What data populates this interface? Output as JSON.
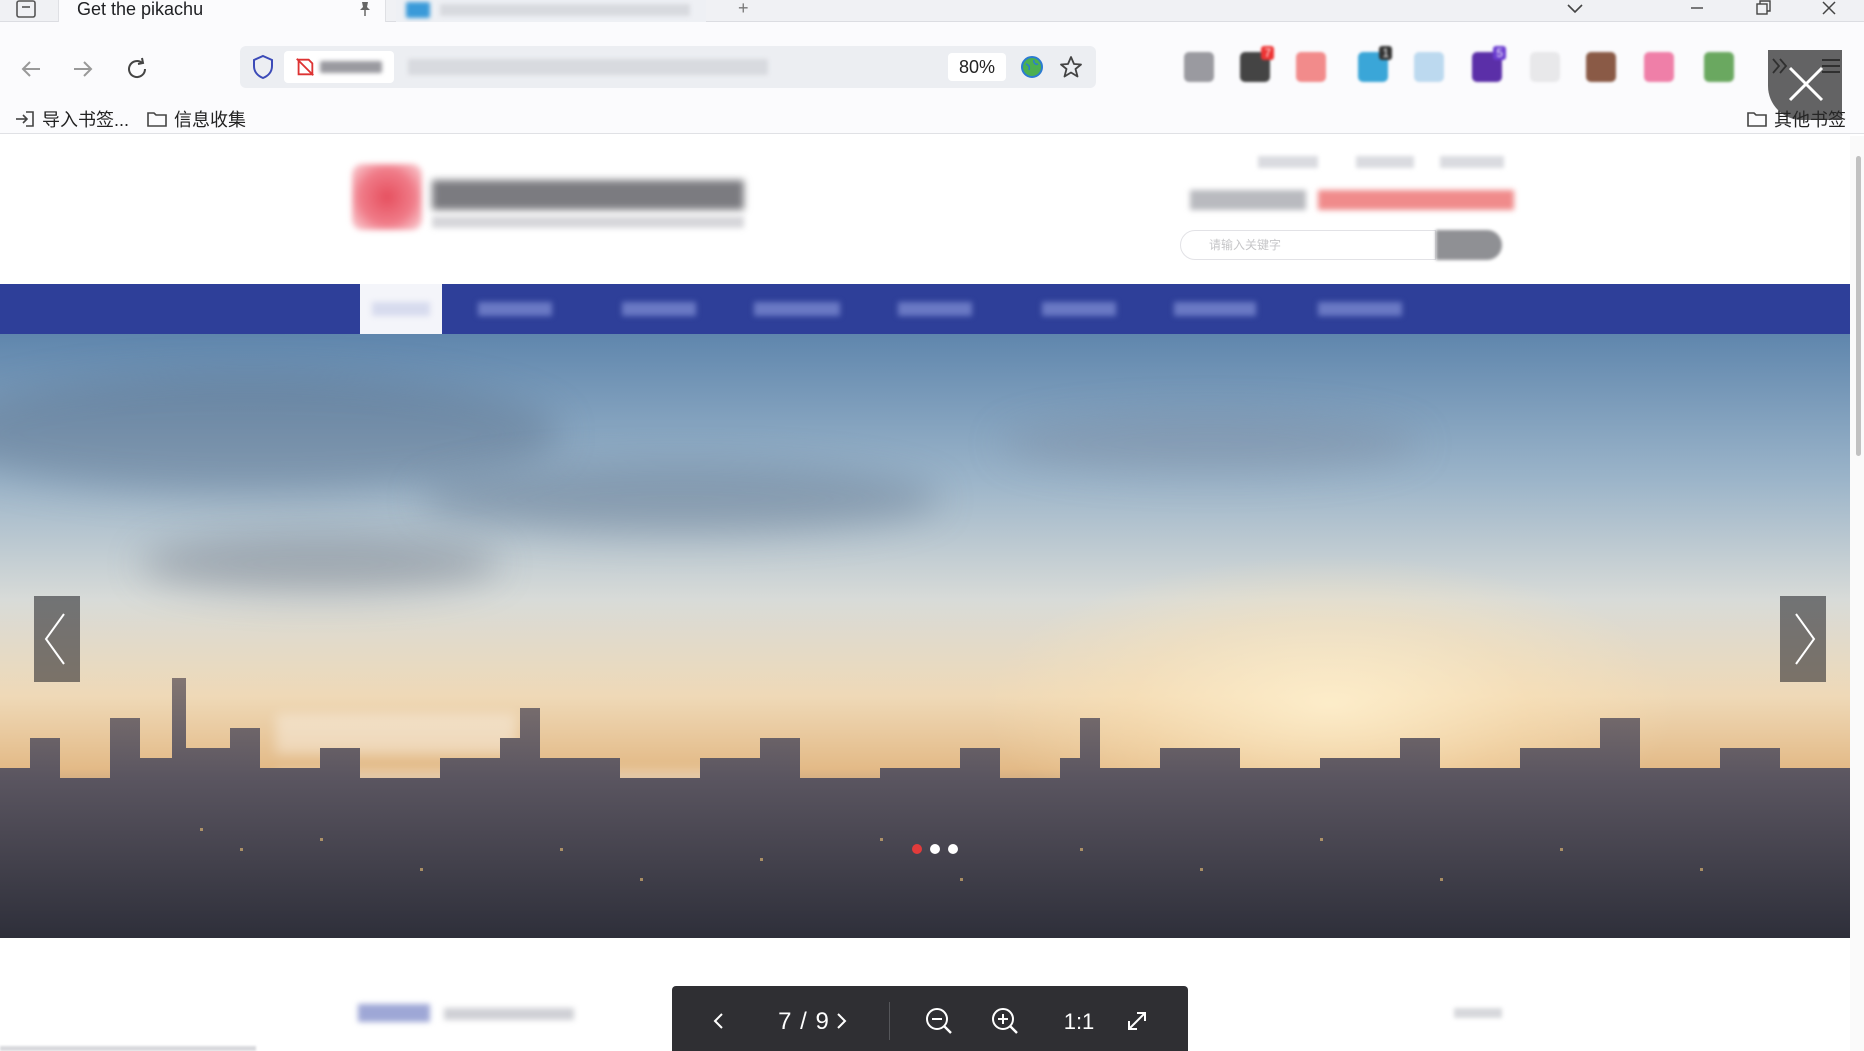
{
  "tab": {
    "title": "Get the pikachu"
  },
  "address_bar": {
    "zoom_level": "80%"
  },
  "bookmarks": {
    "import_label": "导入书签...",
    "folder_label": "信息收集",
    "other_label": "其他书签"
  },
  "site": {
    "search_placeholder": "请输入关键字"
  },
  "carousel": {
    "slide_count": 3,
    "active_slide": 1
  },
  "viewer": {
    "counter": "7 / 9",
    "ratio_label": "1:1"
  },
  "colors": {
    "nav_bar": "#2e3f99",
    "active_dot": "#e23b3b",
    "viewer_toolbar": "#2f2f33"
  },
  "icons": {
    "back": "arrow-left-icon",
    "forward": "arrow-right-icon",
    "reload": "reload-icon",
    "shield": "shield-icon",
    "bookmark_star": "star-icon",
    "close_viewer": "close-icon",
    "zoom_out": "zoom-out-icon",
    "zoom_in": "zoom-in-icon",
    "fullscreen": "expand-icon"
  }
}
